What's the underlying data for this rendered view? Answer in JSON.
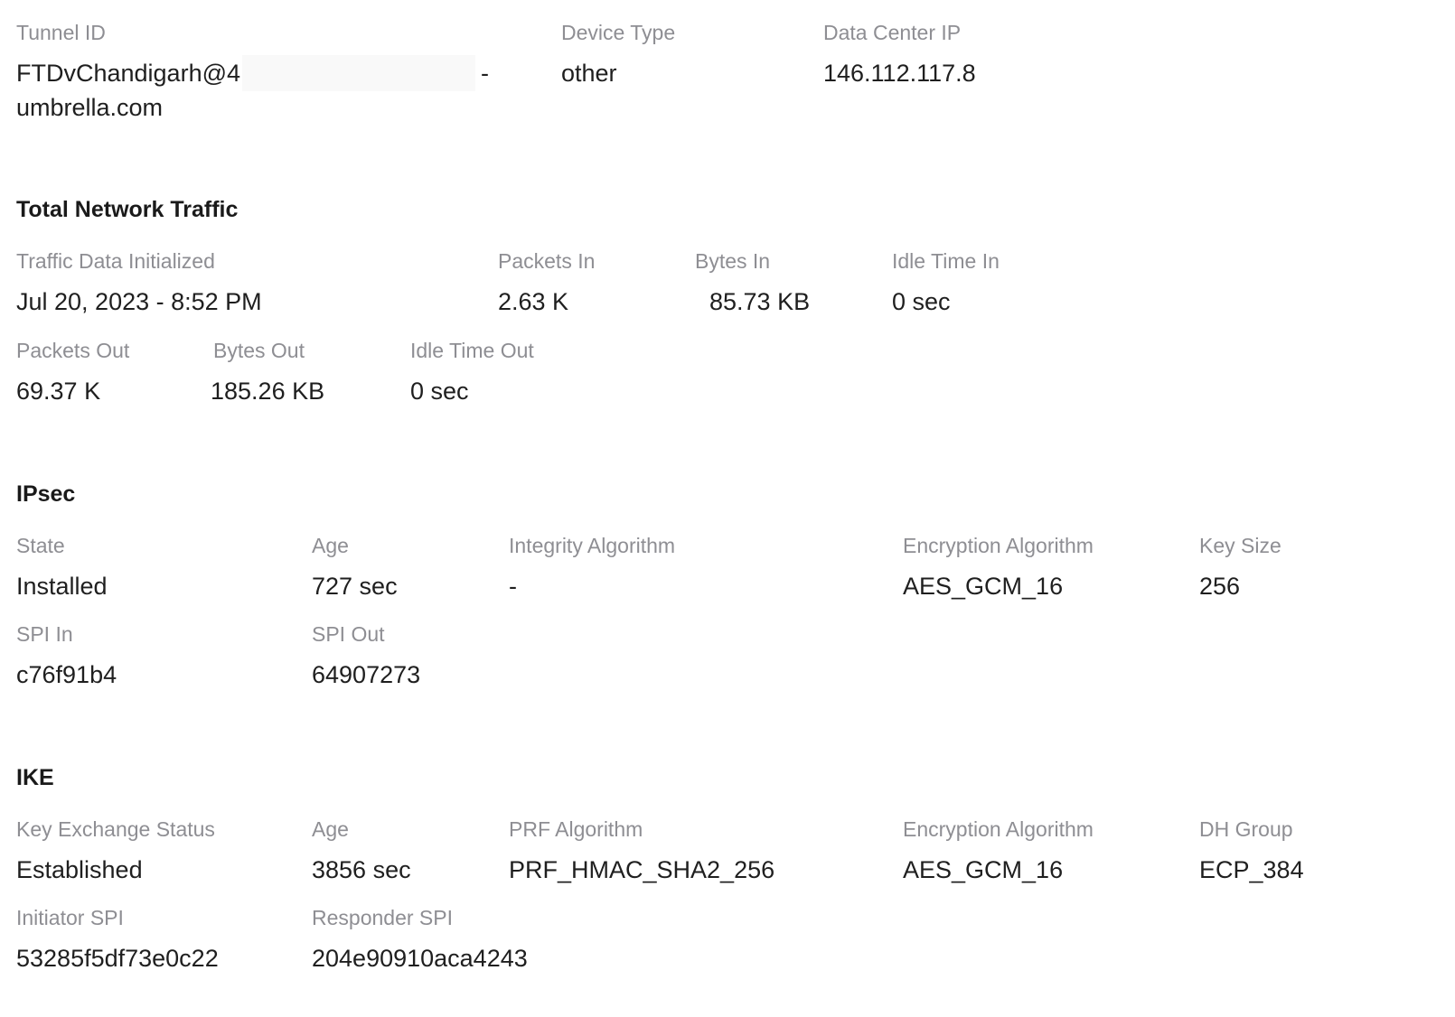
{
  "header": {
    "tunnel_id": {
      "label": "Tunnel ID",
      "value_part1": "FTDvChandigarh@4",
      "value_suffix": "-",
      "value_line2": "umbrella.com"
    },
    "device_type": {
      "label": "Device Type",
      "value": "other"
    },
    "data_center_ip": {
      "label": "Data Center IP",
      "value": "146.112.117.8"
    }
  },
  "traffic": {
    "title": "Total Network Traffic",
    "initialized": {
      "label": "Traffic Data Initialized",
      "value": "Jul 20, 2023 - 8:52 PM"
    },
    "packets_in": {
      "label": "Packets In",
      "value": "2.63 K"
    },
    "bytes_in": {
      "label": "Bytes In",
      "value": "85.73 KB"
    },
    "idle_in": {
      "label": "Idle Time In",
      "value": "0 sec"
    },
    "packets_out": {
      "label": "Packets Out",
      "value": "69.37 K"
    },
    "bytes_out": {
      "label": "Bytes Out",
      "value": "185.26 KB"
    },
    "idle_out": {
      "label": "Idle Time Out",
      "value": "0 sec"
    }
  },
  "ipsec": {
    "title": "IPsec",
    "state": {
      "label": "State",
      "value": "Installed"
    },
    "age": {
      "label": "Age",
      "value": "727 sec"
    },
    "integrity": {
      "label": "Integrity Algorithm",
      "value": "-"
    },
    "encryption": {
      "label": "Encryption Algorithm",
      "value": "AES_GCM_16"
    },
    "key_size": {
      "label": "Key Size",
      "value": "256"
    },
    "spi_in": {
      "label": "SPI In",
      "value": "c76f91b4"
    },
    "spi_out": {
      "label": "SPI Out",
      "value": "64907273"
    }
  },
  "ike": {
    "title": "IKE",
    "status": {
      "label": "Key Exchange Status",
      "value": "Established"
    },
    "age": {
      "label": "Age",
      "value": "3856 sec"
    },
    "prf": {
      "label": "PRF Algorithm",
      "value": "PRF_HMAC_SHA2_256"
    },
    "encryption": {
      "label": "Encryption Algorithm",
      "value": "AES_GCM_16"
    },
    "dh_group": {
      "label": "DH Group",
      "value": "ECP_384"
    },
    "initiator_spi": {
      "label": "Initiator SPI",
      "value": "53285f5df73e0c22"
    },
    "responder_spi": {
      "label": "Responder SPI",
      "value": "204e90910aca4243"
    }
  }
}
